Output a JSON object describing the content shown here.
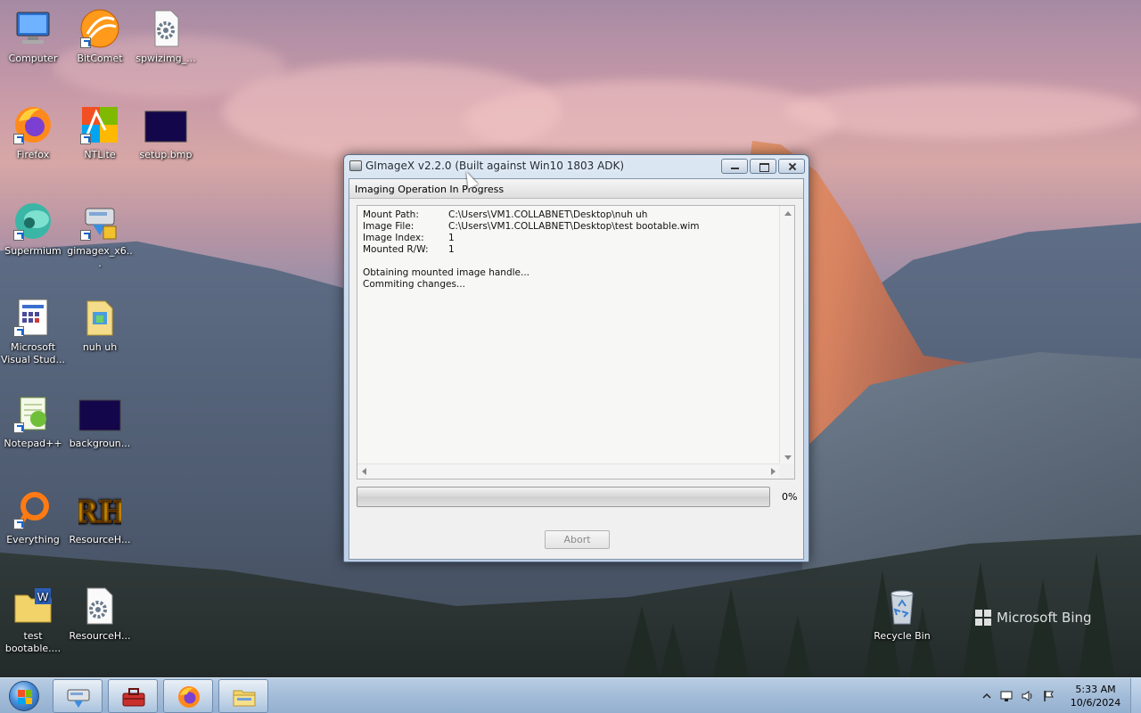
{
  "desktop_icons": [
    {
      "label": "Computer",
      "icon": "computer-icon"
    },
    {
      "label": "BitComet",
      "icon": "bitcomet-icon"
    },
    {
      "label": "spwizimg_...",
      "icon": "settings-file-icon"
    },
    {
      "label": "Firefox",
      "icon": "firefox-icon"
    },
    {
      "label": "NTLite",
      "icon": "ntlite-icon"
    },
    {
      "label": "setup.bmp",
      "icon": "bitmap-icon"
    },
    {
      "label": "Supermium",
      "icon": "supermium-icon"
    },
    {
      "label": "gimagex_x6...",
      "icon": "gimagex-installer-icon"
    },
    {
      "label": "Microsoft Visual Stud...",
      "icon": "visual-studio-icon"
    },
    {
      "label": "nuh uh",
      "icon": "folder-icon"
    },
    {
      "label": "Notepad++",
      "icon": "notepadpp-icon"
    },
    {
      "label": "backgroun...",
      "icon": "bitmap-icon"
    },
    {
      "label": "Everything",
      "icon": "everything-icon"
    },
    {
      "label": "ResourceH...",
      "icon": "resource-hacker-icon"
    },
    {
      "label": "test bootable....",
      "icon": "wim-file-icon"
    },
    {
      "label": "ResourceH...",
      "icon": "settings-file-icon"
    },
    {
      "label": "Recycle Bin",
      "icon": "recycle-bin-icon"
    }
  ],
  "window": {
    "title": "GImageX v2.2.0 (Built against Win10 1803 ADK)",
    "group_title": "Imaging Operation In Progress",
    "log": {
      "fields": [
        {
          "key": "Mount Path:",
          "value": "C:\\Users\\VM1.COLLABNET\\Desktop\\nuh uh"
        },
        {
          "key": "Image File:",
          "value": "C:\\Users\\VM1.COLLABNET\\Desktop\\test bootable.wim"
        },
        {
          "key": "Image Index:",
          "value": "1"
        },
        {
          "key": "Mounted R/W:",
          "value": "1"
        }
      ],
      "messages": [
        "Obtaining mounted image handle...",
        "Commiting changes..."
      ]
    },
    "progress": {
      "value": 0,
      "label": "0%"
    },
    "abort_label": "Abort"
  },
  "watermark": "Microsoft Bing",
  "taskbar": {
    "buttons": [
      "gimagex-icon",
      "toolbox-icon",
      "firefox-icon",
      "file-explorer-icon"
    ],
    "clock": {
      "time": "5:33 AM",
      "date": "10/6/2024"
    },
    "tray_icons": [
      "show-hidden-icons-chevron-icon",
      "network-icon",
      "volume-icon",
      "action-center-flag-icon"
    ]
  },
  "colors": {
    "accent": "#1d4f9a",
    "taskbar": "#a3bcd8",
    "progress": "#3ecb3a"
  }
}
